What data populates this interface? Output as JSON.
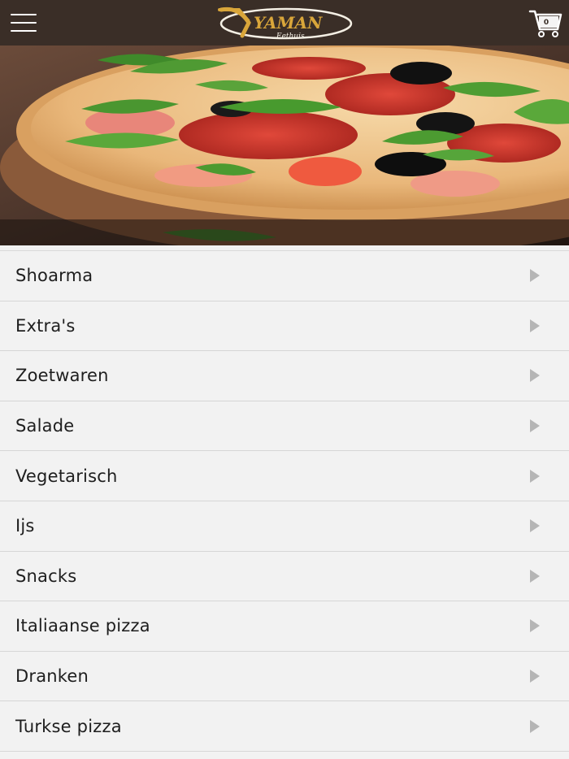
{
  "header": {
    "logo_text": "YAMAN",
    "logo_subtext": "Eethuis",
    "cart_count": "0",
    "menu_icon": "hamburger-menu-icon",
    "cart_icon": "shopping-cart-icon",
    "colors": {
      "bar": "#3a2e27",
      "logo_gold": "#d9a63a",
      "logo_cream": "#f4efe4"
    }
  },
  "hero": {
    "image": "pizza-photo"
  },
  "categories": [
    {
      "label": "Shoarma"
    },
    {
      "label": "Extra's"
    },
    {
      "label": "Zoetwaren"
    },
    {
      "label": "Salade"
    },
    {
      "label": "Vegetarisch"
    },
    {
      "label": "Ijs"
    },
    {
      "label": "Snacks"
    },
    {
      "label": "Italiaanse pizza"
    },
    {
      "label": "Dranken"
    },
    {
      "label": "Turkse pizza"
    }
  ],
  "list": {
    "chevron_icon": "chevron-right-icon",
    "background": "#f2f2f2"
  }
}
